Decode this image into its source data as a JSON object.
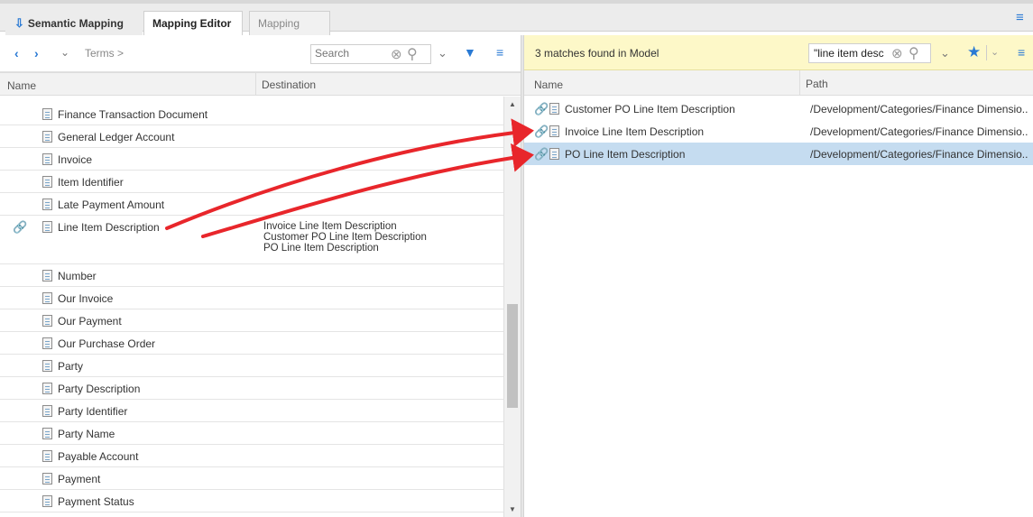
{
  "tabs": [
    {
      "label": "Semantic Mapping",
      "icon": "download-arrow-icon"
    },
    {
      "label": "Mapping Editor",
      "active": true
    },
    {
      "label": "Mapping Reporter"
    }
  ],
  "left": {
    "breadcrumb": "Terms >",
    "search_placeholder": "Search",
    "columns": {
      "name": "Name",
      "destination": "Destination"
    },
    "rows": [
      {
        "name": "Finance Transaction Document",
        "linked": false
      },
      {
        "name": "General Ledger Account",
        "linked": false
      },
      {
        "name": "Invoice",
        "linked": false
      },
      {
        "name": "Item Identifier",
        "linked": false
      },
      {
        "name": "Late Payment Amount",
        "linked": false
      },
      {
        "name": "Line Item Description",
        "linked": true,
        "destinations": [
          "Invoice Line Item Description",
          "Customer PO Line Item Description",
          "PO Line Item Description"
        ]
      },
      {
        "name": "Number",
        "linked": false
      },
      {
        "name": "Our Invoice",
        "linked": false
      },
      {
        "name": "Our Payment",
        "linked": false
      },
      {
        "name": "Our Purchase Order",
        "linked": false
      },
      {
        "name": "Party",
        "linked": false
      },
      {
        "name": "Party Description",
        "linked": false
      },
      {
        "name": "Party Identifier",
        "linked": false
      },
      {
        "name": "Party Name",
        "linked": false
      },
      {
        "name": "Payable Account",
        "linked": false
      },
      {
        "name": "Payment",
        "linked": false
      },
      {
        "name": "Payment Status",
        "linked": false
      }
    ]
  },
  "right": {
    "matches_text": "3 matches found in Model",
    "search_value": "\"line item desc",
    "columns": {
      "name": "Name",
      "path": "Path"
    },
    "rows": [
      {
        "name": "Customer PO Line Item Description",
        "path": "/Development/Categories/Finance Dimensio...",
        "selected": false
      },
      {
        "name": "Invoice Line Item Description",
        "path": "/Development/Categories/Finance Dimensio...",
        "selected": false
      },
      {
        "name": "PO Line Item Description",
        "path": "/Development/Categories/Finance Dimensio...",
        "selected": true
      }
    ]
  },
  "colors": {
    "accent": "#2a7ad4",
    "highlight": "#fdf8c8",
    "selected_row": "#c5dcf0",
    "annotation_arrow": "#e8262b"
  }
}
